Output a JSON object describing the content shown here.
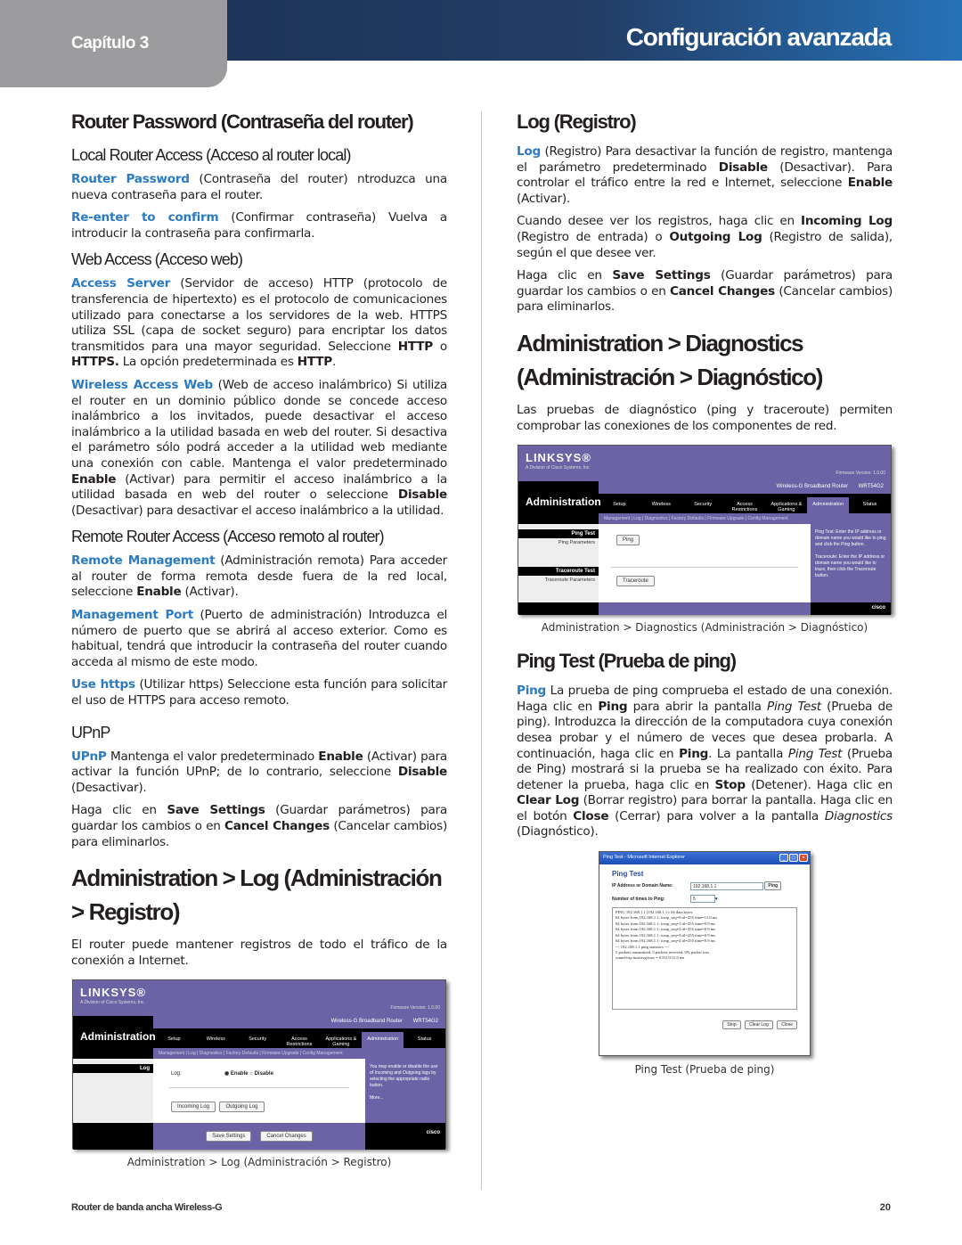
{
  "header": {
    "chapter": "Capítulo 3",
    "title": "Configuración avanzada",
    "colors": {
      "chapter_tab": "#9c9c9e",
      "bar_start": "#1e3458",
      "bar_end": "#2672b8",
      "keyword": "#2b7bc4"
    }
  },
  "left": {
    "h_router_password": "Router Password (Contraseña del router)",
    "h_local_access": "Local Router Access (Acceso al router local)",
    "router_password": {
      "kw": "Router Password",
      "text": " (Contraseña del router) ntroduzca una nueva contraseña para el router."
    },
    "reenter": {
      "kw": "Re-enter to confirm",
      "text": " (Confirmar contraseña) Vuelva a introducir la contraseña para confirmarla."
    },
    "h_web_access": "Web Access (Acceso web)",
    "access_server": {
      "kw": "Access Server",
      "t1": " (Servidor de acceso) HTTP (protocolo de transferencia de hipertexto) es el protocolo de comunicaciones utilizado para conectarse a los servidores de la web. HTTPS utiliza SSL (capa de socket seguro) para encriptar los datos transmitidos para una mayor seguridad. Seleccione ",
      "b1": "HTTP",
      "t2": " o ",
      "b2": "HTTPS.",
      "t3": " La opción predeterminada es ",
      "b3": "HTTP",
      "t4": "."
    },
    "wireless_access": {
      "kw": "Wireless Access Web",
      "t1": "  (Web de acceso inalámbrico) Si utiliza el router en un dominio público donde se concede acceso inalámbrico a los invitados, puede desactivar el acceso inalámbrico a la utilidad basada en web del router. Si desactiva el parámetro sólo podrá acceder a la utilidad web mediante una conexión con cable. Mantenga el valor predeterminado ",
      "b1": "Enable",
      "t2": " (Activar) para permitir el acceso inalámbrico a la utilidad basada en web del router o seleccione ",
      "b2": "Disable",
      "t3": " (Desactivar) para desactivar el acceso inalámbrico a la utilidad."
    },
    "h_remote": "Remote Router Access (Acceso remoto al router)",
    "remote_mgmt": {
      "kw": "Remote Management",
      "t1": " (Administración remota) Para acceder al router de forma remota desde fuera de la red local, seleccione ",
      "b1": "Enable",
      "t2": " (Activar)."
    },
    "mgmt_port": {
      "kw": "Management Port",
      "text": "  (Puerto de administración) Introduzca el número de puerto que se abrirá al acceso exterior. Como es habitual, tendrá que introducir la contraseña del router cuando acceda al mismo de este modo."
    },
    "use_https": {
      "kw": "Use https",
      "text": " (Utilizar https) Seleccione esta función para solicitar el uso de HTTPS para acceso remoto."
    },
    "h_upnp": "UPnP",
    "upnp": {
      "kw": "UPnP",
      "t1": "  Mantenga el valor predeterminado ",
      "b1": "Enable",
      "t2": " (Activar) para activar la función UPnP; de lo contrario, seleccione ",
      "b2": "Disable",
      "t3": " (Desactivar)."
    },
    "save_note": {
      "t1": "Haga clic en ",
      "b1": "Save Settings",
      "t2": " (Guardar parámetros) para guardar los cambios o en ",
      "b2": "Cancel Changes",
      "t3": " (Cancelar cambios) para eliminarlos."
    },
    "h_admin_log": "Administration > Log (Administración > Registro)",
    "admin_log_intro": "El router puede mantener registros de todo el tráfico de la conexión a Internet.",
    "log_caption": "Administration > Log (Administración > Registro)"
  },
  "right": {
    "h_log": "Log (Registro)",
    "log": {
      "kw": "Log",
      "t1": " (Registro) Para desactivar la función de registro, mantenga el parámetro predeterminado ",
      "b1": "Disable",
      "t2": " (Desactivar). Para controlar el tráfico entre la red e Internet, seleccione ",
      "b2": "Enable",
      "t3": " (Activar)."
    },
    "view_logs": {
      "t1": "Cuando desee ver los registros, haga clic en ",
      "b1": "Incoming Log",
      "t2": " (Registro de entrada) o ",
      "b2": "Outgoing Log",
      "t3": " (Registro de salida), según el que desee ver."
    },
    "save_note": {
      "t1": "Haga clic en ",
      "b1": "Save Settings",
      "t2": " (Guardar parámetros) para guardar los cambios o en ",
      "b2": "Cancel Changes",
      "t3": " (Cancelar cambios) para eliminarlos."
    },
    "h_diag": "Administration > Diagnostics (Administración > Diagnóstico)",
    "diag_intro": "Las pruebas de diagnóstico (ping y traceroute) permiten comprobar las conexiones de los componentes de red.",
    "diag_caption": "Administration > Diagnostics (Administración > Diagnóstico)",
    "h_ping": "Ping Test (Prueba de ping)",
    "ping": {
      "kw": "Ping",
      "t1": " La prueba de ping comprueba el estado de una conexión. Haga clic en ",
      "b1": "Ping",
      "t2": " para abrir la pantalla ",
      "i1": "Ping Test",
      "t3": " (Prueba de ping). Introduzca la dirección de la computadora cuya conexión desea probar y el número de veces que desea probarla. A continuación, haga clic en ",
      "b2": "Ping",
      "t4": ". La pantalla ",
      "i2": "Ping Test",
      "t5": " (Prueba de Ping) mostrará si la prueba se ha realizado con éxito. Para detener la prueba, haga clic en ",
      "b3": "Stop",
      "t6": " (Detener). Haga clic en ",
      "b4": "Clear Log",
      "t7": " (Borrar registro) para borrar la pantalla. Haga clic en el botón ",
      "b5": "Close",
      "t8": " (Cerrar) para volver a la pantalla ",
      "i3": "Diagnostics",
      "t9": " (Diagnóstico)."
    },
    "ping_caption": "Ping Test (Prueba de ping)"
  },
  "linksys": {
    "logo": "LINKSYS®",
    "sub": "A Division of Cisco Systems, Inc.",
    "firmware": "Firmware Version: 1.0.00",
    "section": "Administration",
    "product": "Wireless-G Broadband Router",
    "model": "WRT54G2",
    "tabs": [
      "Setup",
      "Wireless",
      "Security",
      "Access Restrictions",
      "Applications & Gaming",
      "Administration",
      "Status"
    ],
    "subtabs": "Management  |  Log  |  Diagnostics  |  Factory Defaults  |  Firmware Upgrade  |  Config Management",
    "cisco": "cisco",
    "log_page": {
      "side_header": "Log",
      "log_label": "Log:",
      "enable": "Enable",
      "disable": "Disable",
      "incoming": "Incoming Log",
      "outgoing": "Outgoing Log",
      "save": "Save Settings",
      "cancel": "Cancel Changes",
      "help": "You may enable or disable the use of Incoming and Outgoing logs by selecting the appropriate radio button.",
      "more": "More..."
    },
    "diag_page": {
      "ping_header": "Ping Test",
      "ping_params": "Ping Parameters",
      "trace_header": "Traceroute Test",
      "trace_params": "Traceroute Parameters",
      "ping_btn": "Ping",
      "trace_btn": "Traceroute",
      "help_ping": "Ping Test: Enter the IP address or domain name you would like to ping and click the Ping button.",
      "help_trace": "Traceroute: Enter the IP address or domain name you would like to trace, then click the Traceroute button."
    }
  },
  "ping_dialog": {
    "window_title": "Ping Test - Microsoft Internet Explorer",
    "heading": "Ping Test",
    "ip_label": "IP Address or Domain Name:",
    "ip_value": "192.168.1.1",
    "ping_btn": "Ping",
    "times_label": "Number of times to Ping:",
    "times_value": "5",
    "log_lines": [
      "PING 192.168.1.1 (192.168.1.1): 56 data bytes",
      "64 bytes from 192.168.1.1: icmp_seq=0 ttl=255 time=11.0 ms",
      "64 bytes from 192.168.1.1: icmp_seq=1 ttl=255 time=0.9 ms",
      "64 bytes from 192.168.1.1: icmp_seq=2 ttl=255 time=0.9 ms",
      "64 bytes from 192.168.1.1: icmp_seq=3 ttl=255 time=0.9 ms",
      "64 bytes from 192.168.1.1: icmp_seq=4 ttl=255 time=0.9 ms",
      "--- 192.168.1.1 ping statistics ---",
      "5 packets transmitted, 5 packets received, 0% packet loss",
      "round-trip min/avg/max = 0.9/2.9/11.0 ms"
    ],
    "stop": "Stop",
    "clear_log": "Clear Log",
    "close": "Close"
  },
  "footer": {
    "product": "Router de banda ancha Wireless-G",
    "page": "20"
  }
}
